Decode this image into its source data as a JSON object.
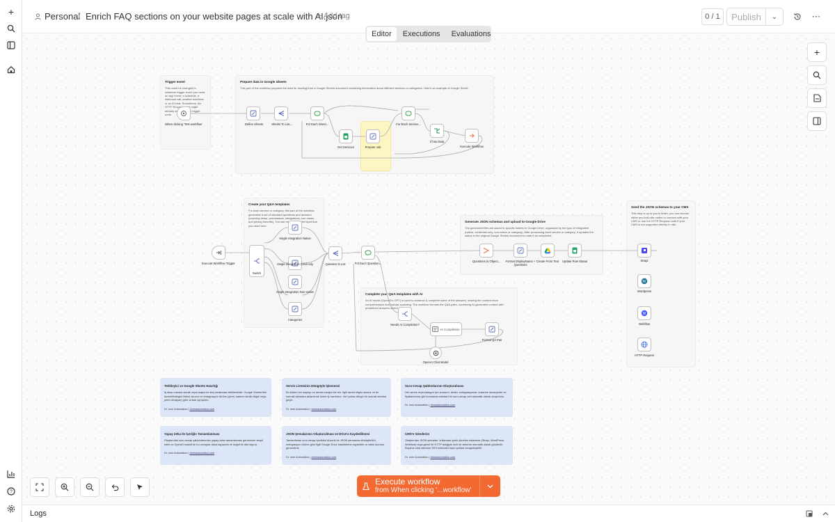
{
  "header": {
    "project": "Personal",
    "separator": "/",
    "workflow_name": "Enrich FAQ sections on your website pages at scale with AI.json",
    "add_tag": "+ Add tag",
    "counter": "0 / 1",
    "publish": "Publish"
  },
  "tabs": [
    {
      "label": "Editor",
      "active": true
    },
    {
      "label": "Executions",
      "active": false
    },
    {
      "label": "Evaluations",
      "active": false
    }
  ],
  "sidebar_icons": [
    "plus-icon",
    "search-icon",
    "panel-icon",
    "home-icon",
    "chart-icon",
    "help-icon",
    "gear-icon"
  ],
  "sticky_notes": [
    {
      "title": "Trigger event",
      "text": "This could be changed to whatever trigger event you need: an app event, a schedule, a webhook call, another workflow or an AI chat. Sometimes, the HTTP Request node might already serve as your trigger node."
    },
    {
      "title": "Prepare data in Google Sheets",
      "text": "This part of the workflow prepares the data for reading from a Google Sheets document containing information about different services or categories. Here's an example of Google Sheet:"
    },
    {
      "title": "Create your Q&A templates",
      "text": "For each service or category, this part of the workflow generates a set of standard questions and answers (covering setup, permissions, integrations, use cases, and pricing benefits). You can modify here the input that you need here."
    },
    {
      "title": "Generate JSON schemas and upload to Google Drive",
      "text": "The generated files are saved to specific folders in Google Drive, organized by the type of integration (native, credential-only, non-native or category). After processing each service or category, it updates the status in the original Google Sheets document to mark it as completed."
    },
    {
      "title": "Complete your Q&A templates with AI",
      "text": "An AI model (OpenAI's GPT) is used to enhance & complete some of the answers, making the content more comprehensive and natural-sounding. The workflow formats the Q&A pairs, combining AI-generated content with predefined answers where applicable."
    },
    {
      "title": "Send the JSON schemas to your CMS",
      "text": "This step is up to you to finish: you can choose either pre-built n8n nodes to connect with your CMS or use the HTTP Request node if your CMS is not supported directly in n8n."
    }
  ],
  "nodes": {
    "trigger": {
      "label": "When clicking 'Test workflow'"
    },
    "define_sheets": {
      "label": "Define Sheets"
    },
    "sheets_to_list": {
      "label": "Sheets To List..."
    },
    "for_each_sheet": {
      "label": "For Each Sheet..."
    },
    "get_services": {
      "label": "Get Services"
    },
    "prepare_job": {
      "label": "Prepare Job"
    },
    "for_each_service": {
      "label": "For Each Service..."
    },
    "if_has_data": {
      "label": "If has Data"
    },
    "execute_workflow": {
      "label": "Execute Workflow"
    },
    "exec_trigger": {
      "label": "Execute Workflow Trigger"
    },
    "switch": {
      "label": "Switch"
    },
    "single_native": {
      "label": "Single Integration Native"
    },
    "single_cred": {
      "label": "Single Integration Cred-only"
    },
    "single_non_native": {
      "label": "Single Integration Non-native"
    },
    "categories": {
      "label": "Categories"
    },
    "question_to_list": {
      "label": "Question to List"
    },
    "for_each_question": {
      "label": "For Each Question..."
    },
    "questions_to_object": {
      "label": "Questions to Object..."
    },
    "format_displayname": {
      "label": "Format DisplayName + Questions"
    },
    "create_from_text": {
      "label": "Create From Text"
    },
    "update_row_status": {
      "label": "Update Row Status"
    },
    "needs_ai": {
      "label": "Needs AI Completion?"
    },
    "ai_completion": {
      "label": "AI Completion"
    },
    "format_qa_pair": {
      "label": "Format QA Pair"
    },
    "openai_chat": {
      "label": "OpenAI Chat Model"
    },
    "strapi": {
      "label": "Strapi"
    },
    "wordpress": {
      "label": "Wordpress"
    },
    "webflow": {
      "label": "Webflow"
    },
    "http_request": {
      "label": "HTTP Request"
    }
  },
  "notes": [
    {
      "title": "Tetikleyici ve Google Sheets Hazırlığı",
      "text": "İş akışı manuel olarak veya başka bir akış tarafından tetiklenebilir. Google Sheets'teki hizmet/kategori listesi okunur ve entegrasyon türüne (yerel, sadece kimlik bilgisi veya yerel olmayan) göre sıralar ayrıştırılır.",
      "footer": "Dr. nnm Automation |",
      "link": "drnmautomation.com"
    },
    {
      "title": "Servis Listesinin Döngüyle İşlenmesi",
      "text": "Bu bölüm her sayfayı ve servisi sırayla ele alır. İlgili servis bilgisi okunur ve bir sonraki adımlara aktarılmak üzere iş hazırlanır. Veri yoksa döngü bir sonraki servise geçer.",
      "footer": "Dr. nnm Automation |",
      "link": "drnmautomation.com"
    },
    {
      "title": "Soru-Cevap Şablonlarının Oluşturulması",
      "text": "Her servis veya kategori için kurulum, izinler, entegrasyonlar, kullanım senaryoları ve fiyatlandırma gibi konularda standart bir soru-cevap seti otomatik olarak oluşturulur.",
      "footer": "Dr. nnm Automation |",
      "link": "drnmautomation.com"
    },
    {
      "title": "Yapay Zeka ile İçeriğin Tamamlanması",
      "text": "Oluşturulan soru-cevap şablonlarından yapay zeka tamamlaması gerekenler tespit edilir ve OpenAI modeli ile bu cevaplar daha kapsamlı ve doğal bir dile taşınır.",
      "footer": "Dr. nnm Automation |",
      "link": "drnmautomation.com"
    },
    {
      "title": "JSON Şemalarının Oluşturulması ve Drive'a Kaydedilmesi",
      "text": "Tamamlanan soru-cevap içerikleri düzenli bir JSON şemasına dönüştürülür, entegrasyon türüne göre ilgili Google Drive klasörlerine kaydedilir ve tablo durumu güncellenir.",
      "footer": "Dr. nnm Automation |",
      "link": "drnmautomation.com"
    },
    {
      "title": "CMS'e Gönderim",
      "text": "Oluşturulan JSON şemaları, kullanılan içerik yönetim sistemine (Strapi, WordPress, Webflow) veya genel bir HTTP isteğiyle özel bir sisteme otomatik olarak gönderilir. Böylece web sitenizin SSS bölümleri toplu şekilde zenginleştirilir.",
      "footer": "Dr. nnm Automation |",
      "link": "drnmautomation.com"
    }
  ],
  "execute": {
    "title": "Execute workflow",
    "subtitle": "from When clicking '...workflow'"
  },
  "logs": {
    "label": "Logs"
  }
}
